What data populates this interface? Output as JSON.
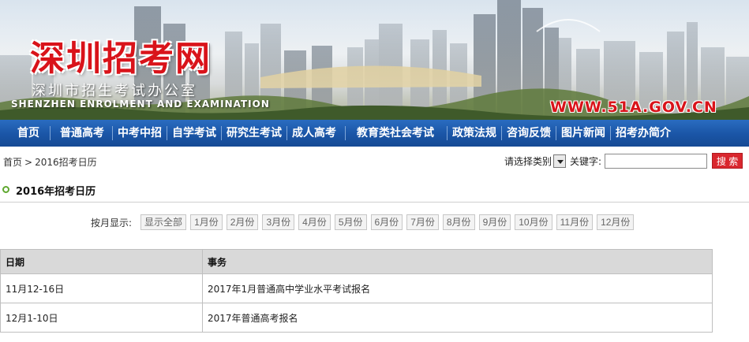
{
  "banner": {
    "title": "深圳招考网",
    "subtitle": "深圳市招生考试办公室",
    "english": "SHENZHEN ENROLMENT AND EXAMINATION",
    "url": "WWW.51A.GOV.CN"
  },
  "nav": [
    "首页",
    "普通高考",
    "中考中招",
    "自学考试",
    "研究生考试",
    "成人高考",
    "教育类社会考试",
    "政策法规",
    "咨询反馈",
    "图片新闻",
    "招考办简介"
  ],
  "breadcrumb": {
    "home": "首页",
    "separator": ">",
    "current": "2016招考日历"
  },
  "search": {
    "category_label": "请选择类别",
    "keyword_label": "关键字:",
    "keyword_value": "",
    "button": "搜 索"
  },
  "section": {
    "title": "2016年招考日历"
  },
  "filter": {
    "label": "按月显示:",
    "buttons": [
      "显示全部",
      "1月份",
      "2月份",
      "3月份",
      "4月份",
      "5月份",
      "6月份",
      "7月份",
      "8月份",
      "9月份",
      "10月份",
      "11月份",
      "12月份"
    ]
  },
  "table": {
    "headers": [
      "日期",
      "事务"
    ],
    "rows": [
      [
        "11月12-16日",
        "2017年1月普通高中学业水平考试报名"
      ],
      [
        "12月1-10日",
        "2017年普通高考报名"
      ]
    ]
  },
  "colors": {
    "brand_red": "#d9131a",
    "nav_blue": "#1a55a6",
    "accent_green": "#5fa82f"
  }
}
